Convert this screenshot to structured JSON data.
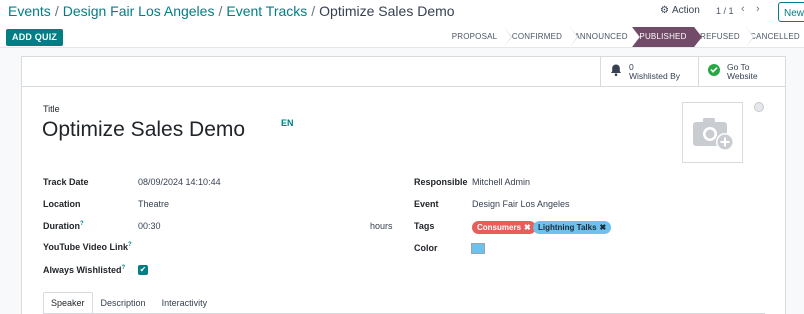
{
  "breadcrumb": {
    "items": [
      "Events",
      "Design Fair Los Angeles",
      "Event Tracks"
    ],
    "current": "Optimize Sales Demo",
    "separator": "/"
  },
  "control": {
    "action_label": "Action",
    "pager": "1 / 1",
    "new_label": "New"
  },
  "header": {
    "add_quiz_label": "ADD QUIZ",
    "stages": [
      "PROPOSAL",
      "CONFIRMED",
      "ANNOUNCED",
      "PUBLISHED",
      "REFUSED",
      "CANCELLED"
    ],
    "active_stage": "PUBLISHED"
  },
  "smart_buttons": {
    "wishlisted_count": "0",
    "wishlisted_label": "Wishlisted By",
    "website_line1": "Go To",
    "website_line2": "Website"
  },
  "form": {
    "title_label": "Title",
    "title_value": "Optimize Sales Demo",
    "lang": "EN",
    "track_date_label": "Track Date",
    "track_date_value": "08/09/2024 14:10:44",
    "location_label": "Location",
    "location_value": "Theatre",
    "duration_label": "Duration",
    "duration_help": "?",
    "duration_value": "00:30",
    "duration_unit": "hours",
    "youtube_label": "YouTube Video Link",
    "youtube_help": "?",
    "always_wishlisted_label": "Always Wishlisted",
    "always_wishlisted_help": "?",
    "always_wishlisted_checked": true,
    "responsible_label": "Responsible",
    "responsible_value": "Mitchell Admin",
    "event_label": "Event",
    "event_value": "Design Fair Los Angeles",
    "tags_label": "Tags",
    "tags": [
      {
        "label": "Consumers",
        "color": "#e85d5a"
      },
      {
        "label": "Lightning Talks",
        "color": "#6cc1ed"
      }
    ],
    "color_label": "Color",
    "color_value": "#6cc1ed"
  },
  "tabs": [
    "Speaker",
    "Description",
    "Interactivity"
  ],
  "active_tab": "Speaker",
  "colors": {
    "accent": "#017e84",
    "active_stage": "#714b67"
  }
}
